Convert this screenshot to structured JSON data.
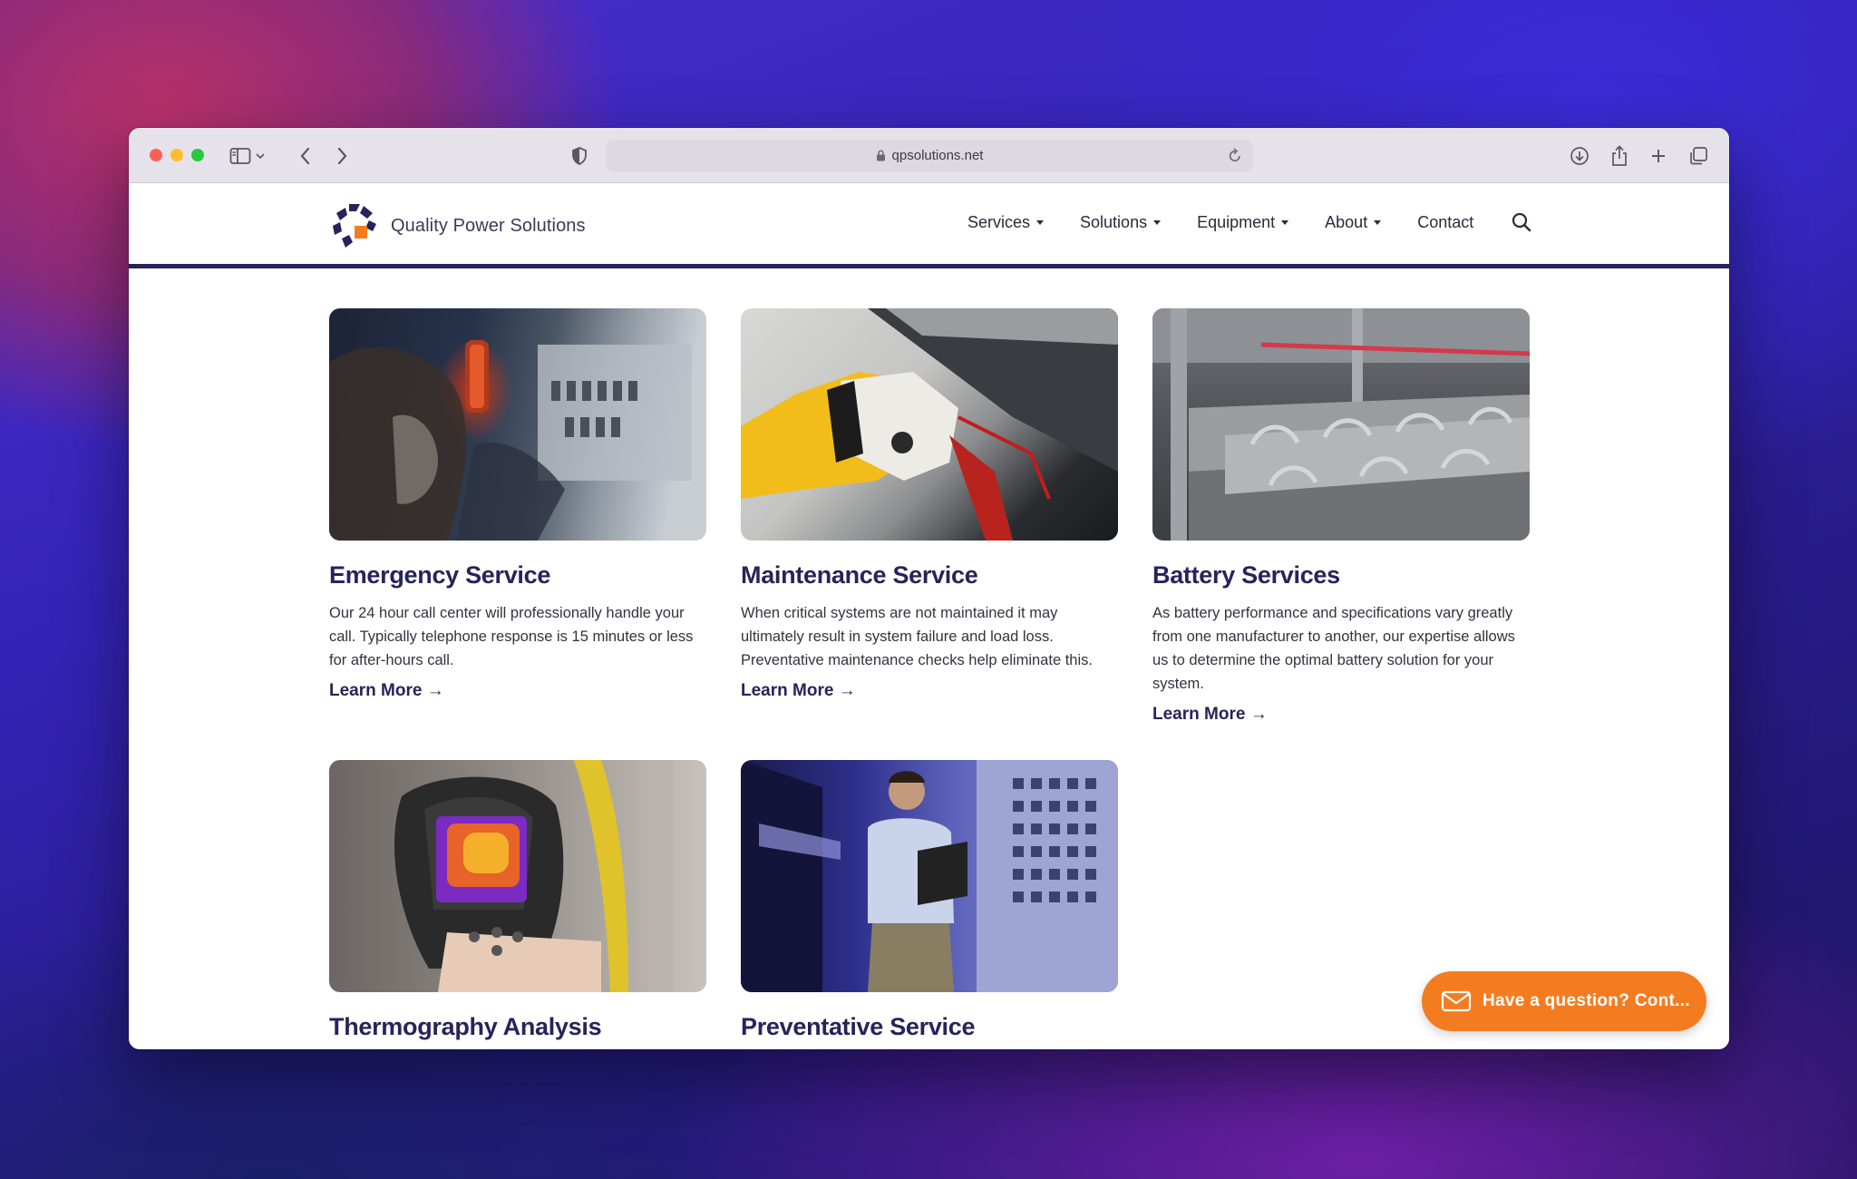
{
  "browser": {
    "url": "qpsolutions.net"
  },
  "site": {
    "logo_text": "Quality Power Solutions",
    "nav": [
      {
        "label": "Services",
        "dropdown": true
      },
      {
        "label": "Solutions",
        "dropdown": true
      },
      {
        "label": "Equipment",
        "dropdown": true
      },
      {
        "label": "About",
        "dropdown": true
      },
      {
        "label": "Contact",
        "dropdown": false
      }
    ],
    "colors": {
      "brand_navy": "#26245a",
      "accent_orange": "#f47c20"
    }
  },
  "cards": [
    {
      "title": "Emergency Service",
      "text": "Our 24 hour call center will professionally handle your call. Typically telephone response is 15 minutes or less for after-hours call.",
      "link": "Learn More →",
      "image": "technician-inspecting-electrical-panel"
    },
    {
      "title": "Maintenance Service",
      "text": "When critical systems are not maintained it may ultimately result in system failure and load loss. Preventative maintenance checks help eliminate this.",
      "link": "Learn More →",
      "image": "gloved-hand-testing-equipment"
    },
    {
      "title": "Battery Services",
      "text": "As battery performance and specifications vary greatly from one manufacturer to another, our expertise allows us to determine the optimal battery solution for your system.",
      "link": "Learn More →",
      "image": "battery-racks"
    },
    {
      "title": "Thermography Analysis",
      "image": "thermal-camera"
    },
    {
      "title": "Preventative Service",
      "image": "engineer-with-tablet-in-server-room"
    }
  ],
  "chat": {
    "label": "Have a question? Cont..."
  }
}
